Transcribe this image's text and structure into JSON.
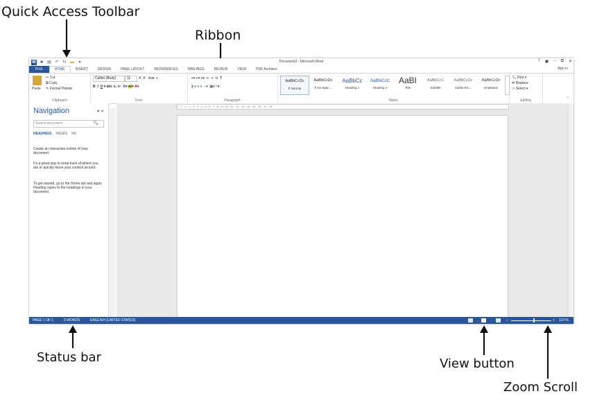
{
  "annotations": {
    "qat": "Quick Access Toolbar",
    "ribbon": "Ribbon",
    "status_bar": "Status bar",
    "view_button": "View button",
    "zoom_scroll": "Zoom Scroll"
  },
  "window": {
    "title": "Document3 - Microsoft Word",
    "help": "?",
    "signin": "Sign in"
  },
  "tabs": [
    "FILE",
    "HOME",
    "INSERT",
    "DESIGN",
    "PAGE LAYOUT",
    "REFERENCES",
    "MAILINGS",
    "REVIEW",
    "VIEW",
    "PDF Architect"
  ],
  "ribbon": {
    "clipboard": {
      "paste": "Paste",
      "cut": "Cut",
      "copy": "Copy",
      "format_painter": "Format Painter",
      "label": "Clipboard"
    },
    "font": {
      "name": "Calibri (Body)",
      "size": "11",
      "label": "Font"
    },
    "paragraph": {
      "label": "Paragraph"
    },
    "styles": {
      "items": [
        {
          "sample": "AaBbCcDc",
          "name": "¶ Normal"
        },
        {
          "sample": "AaBbCcDc",
          "name": "¶ No Spac..."
        },
        {
          "sample": "AaBbCc",
          "name": "Heading 1"
        },
        {
          "sample": "AaBbCcC",
          "name": "Heading 2"
        },
        {
          "sample": "AaBI",
          "name": "Title"
        },
        {
          "sample": "AaBbCcC",
          "name": "Subtitle"
        },
        {
          "sample": "AaBbCcDc",
          "name": "Subtle Em..."
        },
        {
          "sample": "AaBbCcDc",
          "name": "Emphasis"
        }
      ],
      "label": "Styles"
    },
    "editing": {
      "find": "Find",
      "replace": "Replace",
      "select": "Select",
      "label": "Editing"
    }
  },
  "navigation": {
    "title": "Navigation",
    "search_placeholder": "Search document",
    "tabs": [
      "HEADINGS",
      "PAGES",
      "RE"
    ],
    "p1": "Create an interactive outline of your document.",
    "p2": "It's a great way to keep track of where you are or quickly move your content around.",
    "p3": "To get started, go to the Home tab and apply Heading styles to the headings in your document."
  },
  "ruler_ticks": "2 · 1 · 1 · 1 · 2 · 3 · 4 · 5 · 6 · 7 · 8 · 9 · 10 · 11 · 12 · 13 · 14 · 15 · 16 · 17 · 18",
  "status": {
    "page": "PAGE 1 OF 1",
    "words": "0 WORDS",
    "language": "ENGLISH (UNITED STATES)",
    "zoom": "110 %",
    "zoom_level": 0.55
  },
  "colors": {
    "accent": "#2b579a"
  }
}
